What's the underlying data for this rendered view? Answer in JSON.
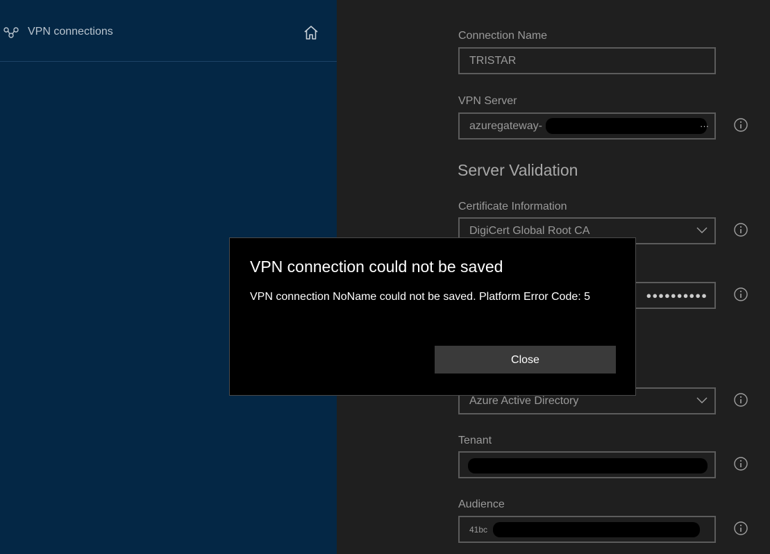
{
  "sidebar": {
    "nav_label": "VPN connections",
    "vpn_icon": "vpn-link-icon",
    "home_icon": "home-icon"
  },
  "form": {
    "connection_name": {
      "label": "Connection Name",
      "value": "TRISTAR"
    },
    "vpn_server": {
      "label": "VPN Server",
      "value": "azuregateway-",
      "overflow": "···"
    },
    "server_validation": {
      "title": "Server Validation"
    },
    "certificate_info": {
      "label": "Certificate Information",
      "value": "DigiCert Global Root CA"
    },
    "secret_field": {
      "value": "●●●●●●●●●●"
    },
    "authentication_type": {
      "value": "Azure Active Directory"
    },
    "tenant": {
      "label": "Tenant"
    },
    "audience": {
      "label": "Audience",
      "value": "41bc"
    }
  },
  "dialog": {
    "title": "VPN connection could not be saved",
    "message": "VPN connection NoName could not be saved. Platform Error Code: 5",
    "close_label": "Close"
  },
  "colors": {
    "sidebar_bg": "#042745",
    "main_bg": "#1f1f1f",
    "dialog_bg": "#000000",
    "button_bg": "#3a3a3a"
  }
}
